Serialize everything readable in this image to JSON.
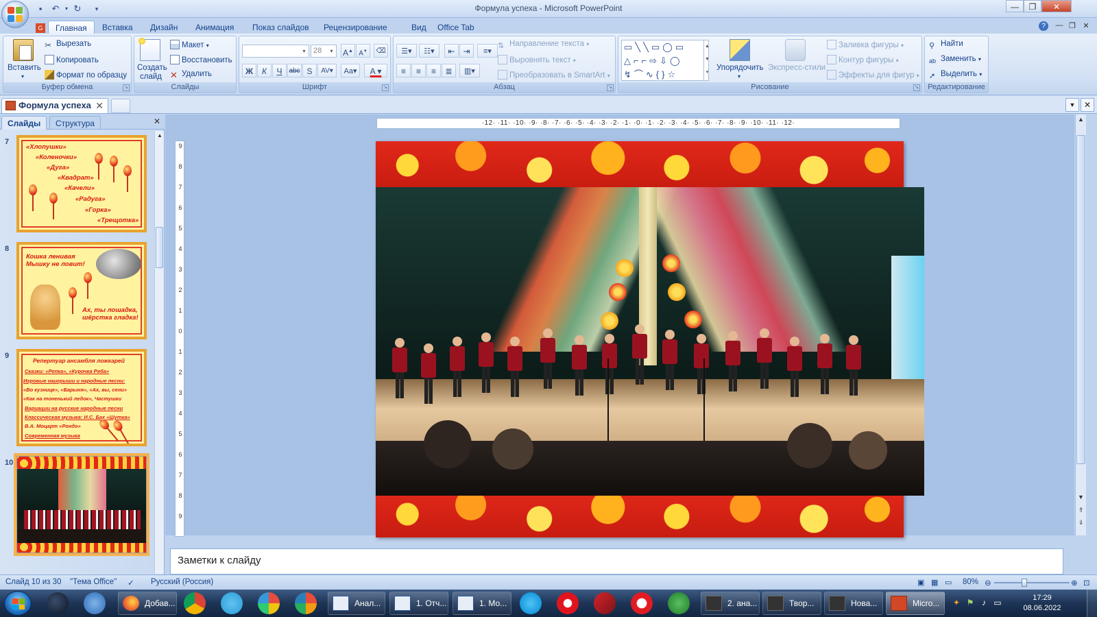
{
  "window": {
    "title": "Формула успеха - Microsoft PowerPoint"
  },
  "ribbon": {
    "tabs": [
      "Главная",
      "Вставка",
      "Дизайн",
      "Анимация",
      "Показ слайдов",
      "Рецензирование",
      "Вид",
      "Office Tab"
    ],
    "clipboard": {
      "label": "Буфер обмена",
      "paste": "Вставить",
      "cut": "Вырезать",
      "copy": "Копировать",
      "format_painter": "Формат по образцу"
    },
    "slides": {
      "label": "Слайды",
      "new_slide": "Создать слайд",
      "layout": "Макет",
      "reset": "Восстановить",
      "delete": "Удалить"
    },
    "font": {
      "label": "Шрифт",
      "font_name": "",
      "font_size": "28"
    },
    "paragraph": {
      "label": "Абзац",
      "text_direction": "Направление текста",
      "align_text": "Выровнять текст",
      "smartart": "Преобразовать в SmartArt"
    },
    "drawing": {
      "label": "Рисование",
      "arrange": "Упорядочить",
      "quick_styles": "Экспресс-стили",
      "shape_fill": "Заливка фигуры",
      "shape_outline": "Контур фигуры",
      "shape_effects": "Эффекты для фигур"
    },
    "editing": {
      "label": "Редактирование",
      "find": "Найти",
      "replace": "Заменить",
      "select": "Выделить"
    }
  },
  "document_tab": {
    "name": "Формула успеха"
  },
  "slides_pane": {
    "tabs": [
      "Слайды",
      "Структура"
    ],
    "thumbnails": [
      {
        "number": "7",
        "lines": [
          "«Хлопушки»",
          "«Коленочки»",
          "«Дуга»",
          "«Квадрат»",
          "«Качели»",
          "«Радуга»",
          "«Горка»",
          "«Трещотка»"
        ]
      },
      {
        "number": "8",
        "lines": [
          "Кошка ленивая",
          "Мышку не ловит!",
          "Ах, ты лошадка,",
          "шёрстка гладка!"
        ]
      },
      {
        "number": "9",
        "lines": [
          "Репертуар ансамбля ложкарей",
          "Сказки:   «Репка»,    «Курочка Ряба»",
          "Игровые наигрыши и народные песни:",
          "«Во кузнице», «Барыня», «Ах, вы, сени»",
          "«Как на тоненький ледок»,   Частушки",
          "Вариации на русские народные песни",
          "Классическая музыка: И.С. Бах «Шутка»",
          "В.А. Моцарт «Рондо»",
          "Современная музыка"
        ]
      },
      {
        "number": "10",
        "lines": []
      }
    ]
  },
  "ruler": {
    "horizontal": "·12·  ·11·  ·10·  ·9·  ·8·  ·7·  ·6·  ·5·  ·4·  ·3·  ·2·  ·1·  ·0·  ·1·  ·2·  ·3·  ·4·  ·5·  ·6·  ·7·  ·8·  ·9·  ·10·  ·11·  ·12·",
    "vertical": [
      "9",
      "8",
      "7",
      "6",
      "5",
      "4",
      "3",
      "2",
      "1",
      "0",
      "1",
      "2",
      "3",
      "4",
      "5",
      "6",
      "7",
      "8",
      "9"
    ]
  },
  "notes": {
    "placeholder": "Заметки к слайду"
  },
  "statusbar": {
    "slide_info": "Слайд 10 из 30",
    "theme": "\"Тема Office\"",
    "language": "Русский (Россия)",
    "zoom": "80%"
  },
  "taskbar": {
    "buttons": [
      {
        "label": "Добав..."
      },
      {
        "label": "Анал..."
      },
      {
        "label": "1. Отч..."
      },
      {
        "label": "1. Мо..."
      },
      {
        "label": "2. ана..."
      },
      {
        "label": "Твор..."
      },
      {
        "label": "Нова..."
      },
      {
        "label": "Micro..."
      }
    ],
    "time": "17:29",
    "date": "08.06.2022"
  }
}
